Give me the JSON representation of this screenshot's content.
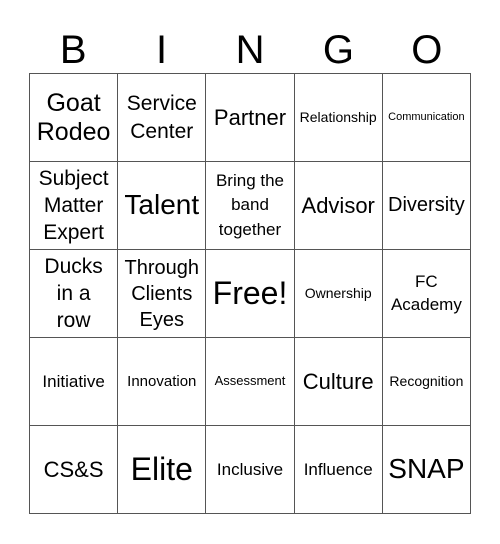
{
  "header": {
    "letters": [
      "B",
      "I",
      "N",
      "G",
      "O"
    ]
  },
  "cells": [
    [
      "Goat\nRodeo",
      "Service\nCenter",
      "Partner",
      "Relationship",
      "Communication"
    ],
    [
      "Subject\nMatter\nExpert",
      "Talent",
      "Bring the\nband\ntogether",
      "Advisor",
      "Diversity"
    ],
    [
      "Ducks\nin a\nrow",
      "Through\nClients\nEyes",
      "Free!",
      "Ownership",
      "FC\nAcademy"
    ],
    [
      "Initiative",
      "Innovation",
      "Assessment",
      "Culture",
      "Recognition"
    ],
    [
      "CS&S",
      "Elite",
      "Inclusive",
      "Influence",
      "SNAP"
    ]
  ]
}
